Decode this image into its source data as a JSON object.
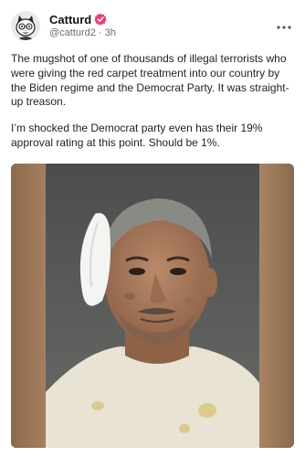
{
  "post": {
    "author": {
      "display_name": "Catturd",
      "handle": "@catturd2",
      "separator": "·",
      "time_ago": "3h",
      "verified_badge_color": "#e8407a",
      "avatar_icon": "cartoon-cat-avatar"
    },
    "more_icon": "more-dots-icon",
    "paragraphs": [
      "The mugshot of one of thousands of illegal terrorists who were giving the red carpet treatment into our country by the Biden regime and the Democrat Party. It was straight-up treason.",
      "I’m shocked the Democrat party even has their 19% approval rating at this point. Should be 1%."
    ],
    "media": {
      "type": "mugshot-photo",
      "background_color": "#5c5f5f"
    }
  }
}
